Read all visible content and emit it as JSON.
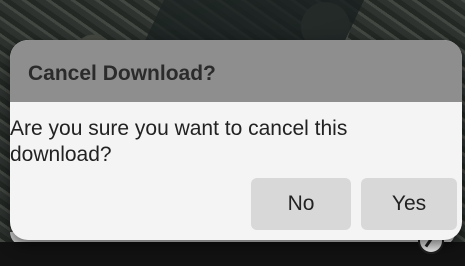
{
  "dialog": {
    "title": "Cancel Download?",
    "message": "Are you sure you want to cancel this download?",
    "buttons": {
      "no_label": "No",
      "yes_label": "Yes"
    }
  },
  "colors": {
    "title_bar": "#8e8e8e",
    "dialog_body": "#f4f4f4",
    "button_bg": "#d8d8d8",
    "text": "#222222"
  },
  "icons": {
    "map_compass": "compass-icon"
  }
}
